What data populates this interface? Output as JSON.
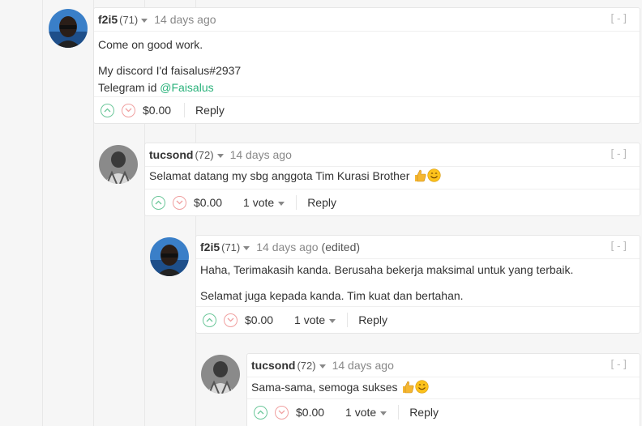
{
  "comments": [
    {
      "author": "f2i5",
      "rep": "(71)",
      "time": "14 days ago",
      "edited": "",
      "collapse": "[-]",
      "paragraphs": [
        "Come on good work."
      ],
      "line1": "My discord I'd faisalus#2937",
      "line2_prefix": "Telegram id ",
      "line2_link": "@Faisalus",
      "amount": "$0.00",
      "votes": "",
      "reply": "Reply"
    },
    {
      "author": "tucsond",
      "rep": "(72)",
      "time": "14 days ago",
      "collapse": "[-]",
      "text": "Selamat datang my sbg anggota Tim Kurasi Brother",
      "amount": "$0.00",
      "votes": "1 vote",
      "reply": "Reply"
    },
    {
      "author": "f2i5",
      "rep": "(71)",
      "time": "14 days ago",
      "edited": "(edited)",
      "collapse": "[-]",
      "p1": "Haha, Terimakasih kanda. Berusaha bekerja maksimal untuk yang terbaik.",
      "p2": "Selamat juga kepada kanda. Tim kuat dan bertahan.",
      "amount": "$0.00",
      "votes": "1 vote",
      "reply": "Reply"
    },
    {
      "author": "tucsond",
      "rep": "(72)",
      "time": "14 days ago",
      "collapse": "[-]",
      "text": "Sama-sama, semoga sukses",
      "amount": "$0.00",
      "votes": "1 vote",
      "reply": "Reply"
    }
  ],
  "colors": {
    "upvote": "#6cc79a",
    "downvote": "#f0a0a0",
    "link": "#2ab27b"
  },
  "icons": [
    "upvote-icon",
    "downvote-icon",
    "thumbs-up-emoji",
    "smile-emoji",
    "caret-down-icon"
  ]
}
